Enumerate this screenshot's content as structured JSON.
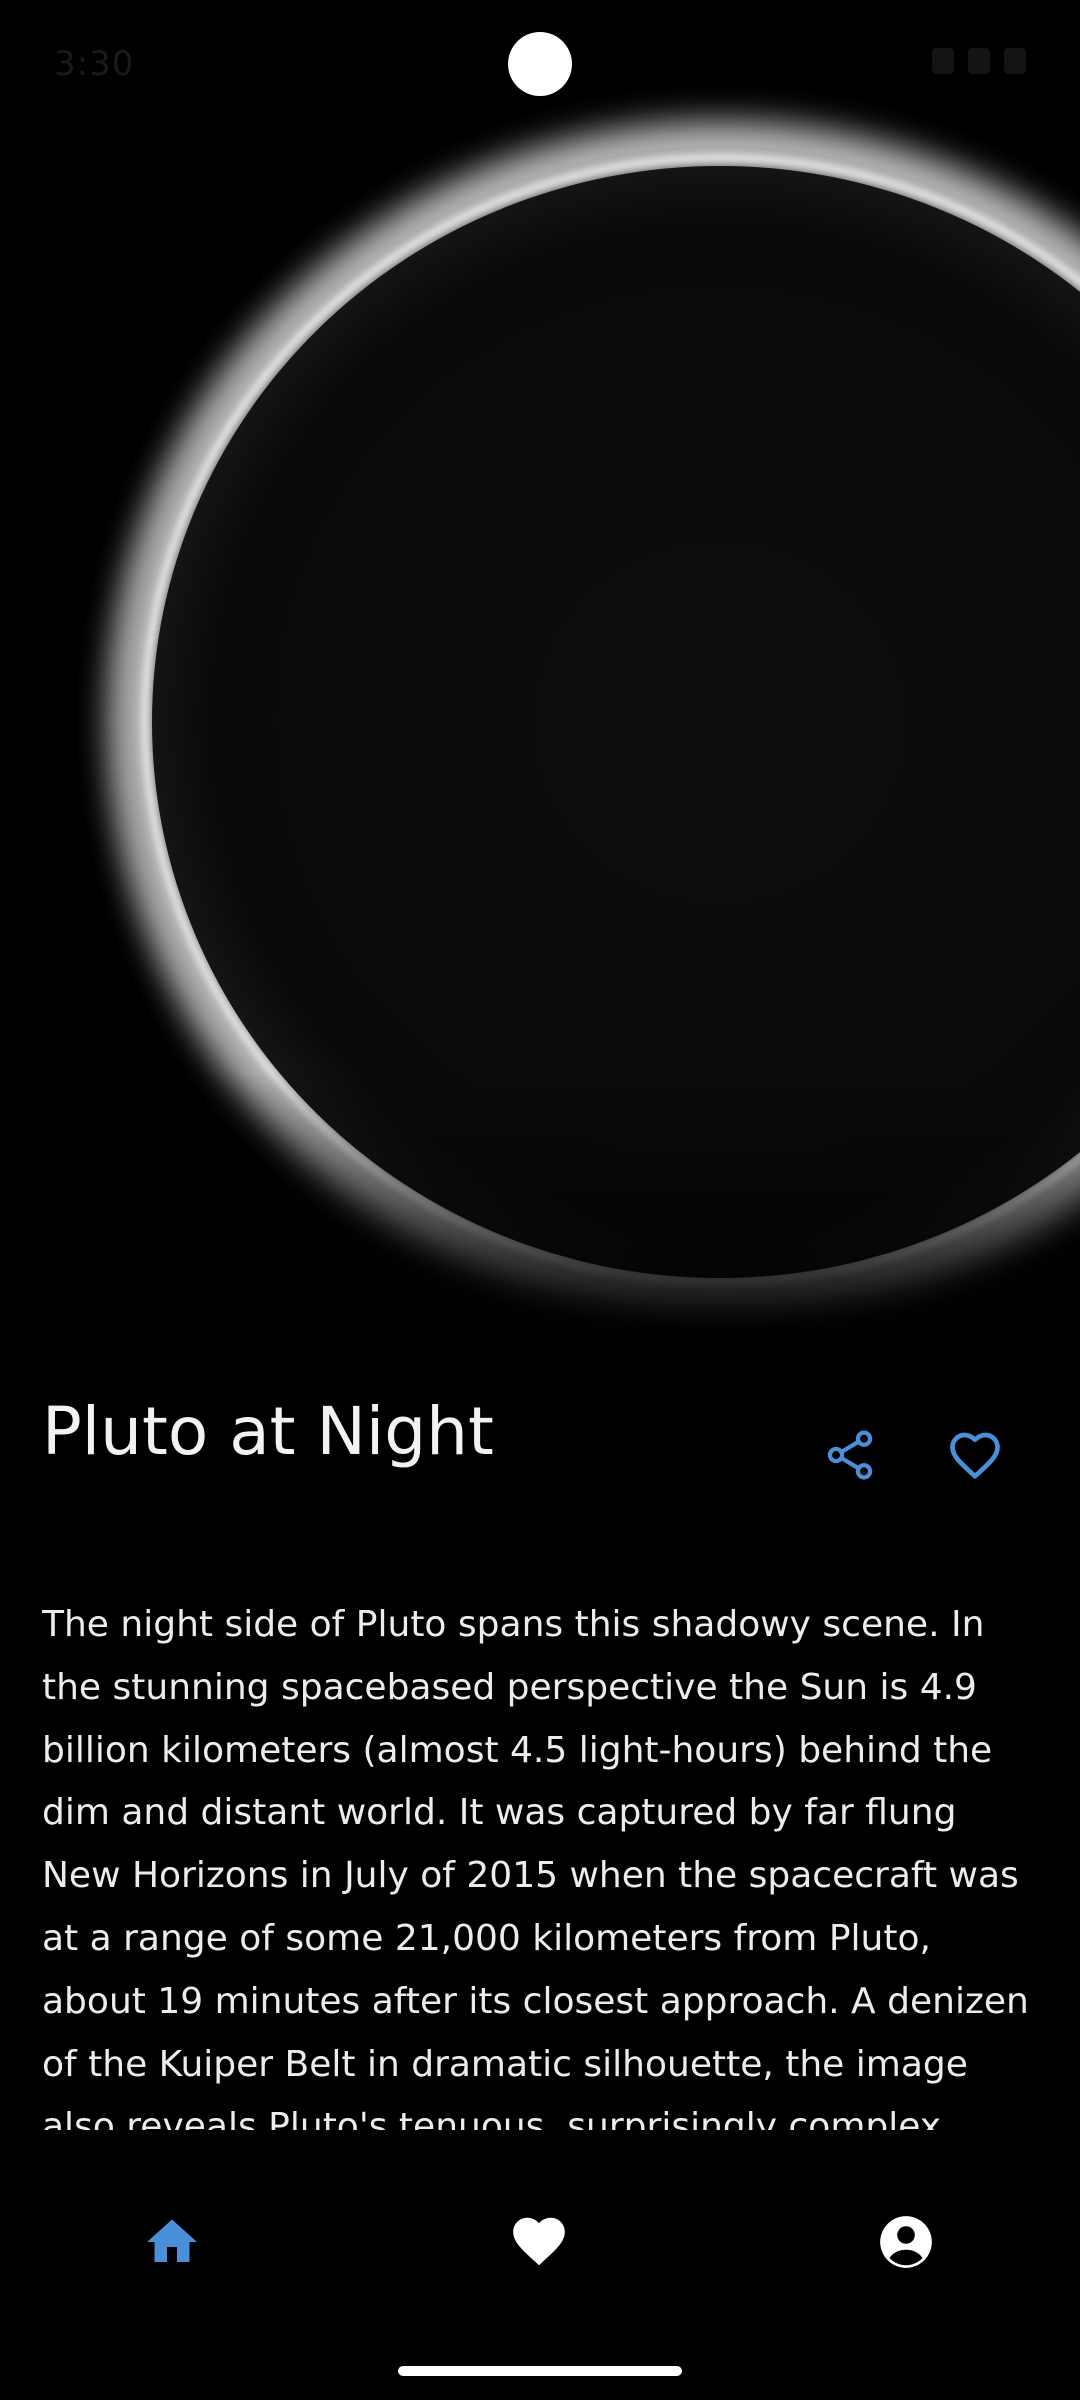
{
  "status_bar": {
    "time": "3:30"
  },
  "article": {
    "title": "Pluto at Night",
    "description": "The night side of Pluto spans this shadowy scene. In the stunning spacebased perspective the Sun is 4.9 billion kilometers (almost 4.5 light-hours) behind the dim and distant world. It was captured by far flung New Horizons in July of 2015 when the spacecraft was at a range of some 21,000 kilometers from Pluto, about 19 minutes after its closest approach. A denizen of the Kuiper Belt in dramatic silhouette, the image also reveals Pluto's tenuous, surprisingly complex layers of hazy atmosphere."
  },
  "icons": {
    "share": "share-icon",
    "favorite": "heart-outline-icon",
    "nav_home": "home-icon",
    "nav_favorites": "heart-filled-icon",
    "nav_profile": "account-circle-icon"
  },
  "colors": {
    "accent": "#4a90d9",
    "background": "#000000",
    "text": "#ececec",
    "nav_inactive": "#ffffff"
  }
}
